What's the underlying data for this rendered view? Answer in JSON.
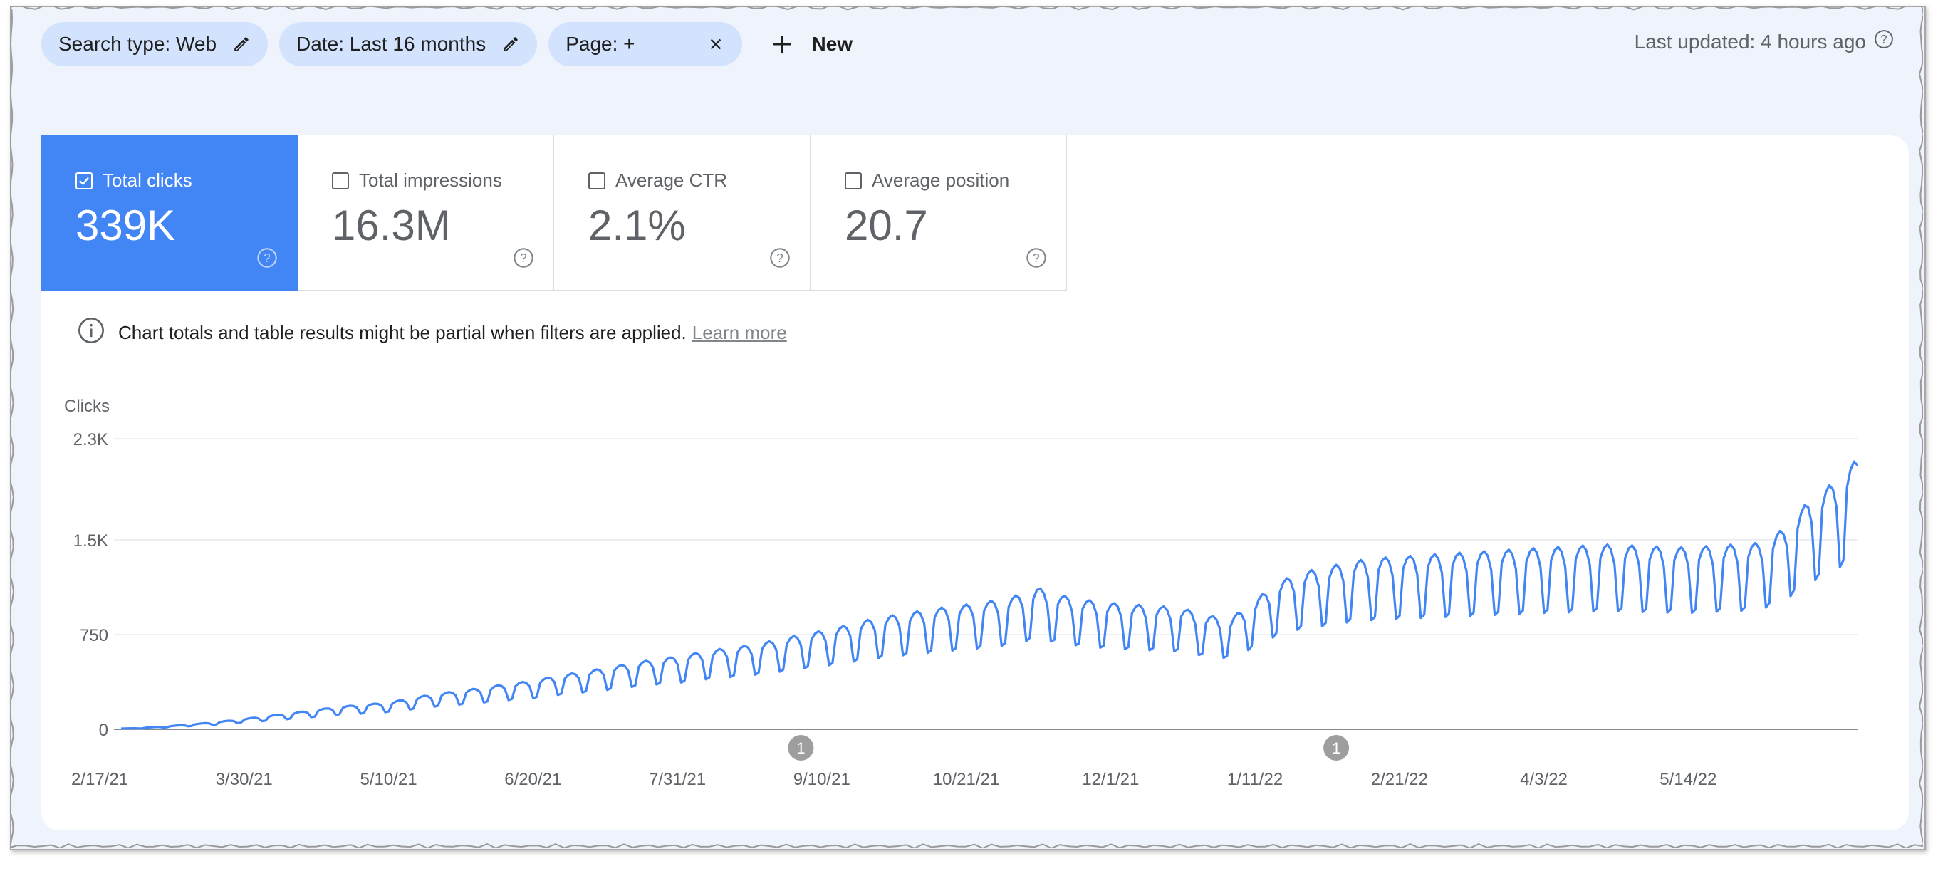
{
  "filters": {
    "search_type": "Search type: Web",
    "date": "Date: Last 16 months",
    "page": "Page: +",
    "new_label": "New"
  },
  "last_updated": "Last updated: 4 hours ago",
  "metrics": [
    {
      "label": "Total clicks",
      "value": "339K",
      "checked": true
    },
    {
      "label": "Total impressions",
      "value": "16.3M",
      "checked": false
    },
    {
      "label": "Average CTR",
      "value": "2.1%",
      "checked": false
    },
    {
      "label": "Average position",
      "value": "20.7",
      "checked": false
    }
  ],
  "notice": {
    "text": "Chart totals and table results might be partial when filters are applied.",
    "link": "Learn more"
  },
  "colors": {
    "accent": "#4285f4",
    "chip_bg": "#d3e3fd",
    "page_bg": "#eef3fc",
    "annotation": "#9e9e9e"
  },
  "icons": [
    "pencil-icon",
    "close-icon",
    "plus-icon",
    "help-icon",
    "checkbox-icon",
    "info-icon"
  ],
  "chart_data": {
    "type": "line",
    "ylabel": "Clicks",
    "xlabel": "",
    "ylim": [
      0,
      2300
    ],
    "yticks": [
      0,
      750,
      1500,
      2300
    ],
    "ytick_labels": [
      "0",
      "750",
      "1.5K",
      "2.3K"
    ],
    "x_start": "2021-02-17",
    "x_end": "2022-06-25",
    "xtick_labels": [
      "2/17/21",
      "3/30/21",
      "5/10/21",
      "6/20/21",
      "7/31/21",
      "9/10/21",
      "10/21/21",
      "12/1/21",
      "1/11/22",
      "2/21/22",
      "4/3/22",
      "5/14/22"
    ],
    "grid": true,
    "annotations": [
      {
        "label": "1",
        "date": "2021-08-29"
      },
      {
        "label": "1",
        "date": "2022-01-28"
      }
    ],
    "series": [
      {
        "name": "Clicks",
        "color": "#4285f4",
        "points": [
          [
            "2021-02-17",
            5
          ],
          [
            "2021-02-22",
            8
          ],
          [
            "2021-03-01",
            18
          ],
          [
            "2021-03-08",
            30
          ],
          [
            "2021-03-15",
            45
          ],
          [
            "2021-03-22",
            62
          ],
          [
            "2021-03-30",
            85
          ],
          [
            "2021-04-06",
            105
          ],
          [
            "2021-04-13",
            125
          ],
          [
            "2021-04-20",
            148
          ],
          [
            "2021-04-27",
            160
          ],
          [
            "2021-05-04",
            175
          ],
          [
            "2021-05-10",
            200
          ],
          [
            "2021-05-17",
            230
          ],
          [
            "2021-05-24",
            250
          ],
          [
            "2021-06-01",
            275
          ],
          [
            "2021-06-08",
            300
          ],
          [
            "2021-06-14",
            315
          ],
          [
            "2021-06-20",
            345
          ],
          [
            "2021-06-27",
            370
          ],
          [
            "2021-07-05",
            400
          ],
          [
            "2021-07-12",
            430
          ],
          [
            "2021-07-19",
            455
          ],
          [
            "2021-07-26",
            475
          ],
          [
            "2021-07-31",
            500
          ],
          [
            "2021-08-07",
            525
          ],
          [
            "2021-08-14",
            545
          ],
          [
            "2021-08-21",
            575
          ],
          [
            "2021-08-28",
            610
          ],
          [
            "2021-09-04",
            640
          ],
          [
            "2021-09-10",
            670
          ],
          [
            "2021-09-17",
            710
          ],
          [
            "2021-09-24",
            740
          ],
          [
            "2021-10-01",
            765
          ],
          [
            "2021-10-08",
            790
          ],
          [
            "2021-10-15",
            810
          ],
          [
            "2021-10-21",
            830
          ],
          [
            "2021-10-28",
            860
          ],
          [
            "2021-11-04",
            920
          ],
          [
            "2021-11-11",
            870
          ],
          [
            "2021-11-18",
            840
          ],
          [
            "2021-11-25",
            820
          ],
          [
            "2021-12-01",
            810
          ],
          [
            "2021-12-08",
            800
          ],
          [
            "2021-12-15",
            790
          ],
          [
            "2021-12-22",
            740
          ],
          [
            "2021-12-29",
            720
          ],
          [
            "2022-01-04",
            820
          ],
          [
            "2022-01-11",
            950
          ],
          [
            "2022-01-18",
            1020
          ],
          [
            "2022-01-25",
            1050
          ],
          [
            "2022-02-01",
            1090
          ],
          [
            "2022-02-08",
            1110
          ],
          [
            "2022-02-14",
            1120
          ],
          [
            "2022-02-21",
            1130
          ],
          [
            "2022-02-28",
            1140
          ],
          [
            "2022-03-07",
            1150
          ],
          [
            "2022-03-14",
            1160
          ],
          [
            "2022-03-21",
            1170
          ],
          [
            "2022-03-28",
            1180
          ],
          [
            "2022-04-03",
            1185
          ],
          [
            "2022-04-10",
            1195
          ],
          [
            "2022-04-17",
            1200
          ],
          [
            "2022-04-24",
            1190
          ],
          [
            "2022-05-01",
            1185
          ],
          [
            "2022-05-08",
            1180
          ],
          [
            "2022-05-14",
            1190
          ],
          [
            "2022-05-21",
            1200
          ],
          [
            "2022-05-28",
            1210
          ],
          [
            "2022-06-04",
            1300
          ],
          [
            "2022-06-11",
            1480
          ],
          [
            "2022-06-18",
            1600
          ],
          [
            "2022-06-25",
            1760
          ]
        ]
      }
    ]
  }
}
